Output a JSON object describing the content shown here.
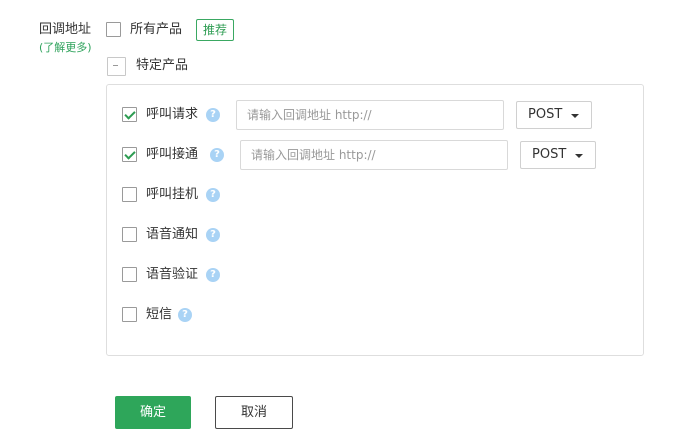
{
  "form": {
    "label": "回调地址",
    "learn_more": "(了解更多)",
    "all_products": {
      "label": "所有产品",
      "checked": false,
      "badge": "推荐"
    },
    "specific_products": {
      "label": "特定产品",
      "state": "indeterminate"
    }
  },
  "products": [
    {
      "label": "呼叫请求",
      "checked": true,
      "url_placeholder": "请输入回调地址 http://",
      "method": "POST",
      "help_icon": "question-circle-icon"
    },
    {
      "label": "呼叫接通",
      "checked": true,
      "url_placeholder": "请输入回调地址 http://",
      "method": "POST",
      "help_icon": "question-circle-icon"
    },
    {
      "label": "呼叫挂机",
      "checked": false,
      "help_icon": "question-circle-icon"
    },
    {
      "label": "语音通知",
      "checked": false,
      "help_icon": "question-circle-icon"
    },
    {
      "label": "语音验证",
      "checked": false,
      "help_icon": "question-circle-icon"
    },
    {
      "label": "短信",
      "checked": false,
      "help_icon": "question-circle-icon"
    }
  ],
  "help_glyph": "?",
  "buttons": {
    "confirm": "确定",
    "cancel": "取消"
  },
  "colors": {
    "accent": "#2ea65a",
    "help_icon": "#a9d3f5",
    "link": "#2fa35c"
  }
}
